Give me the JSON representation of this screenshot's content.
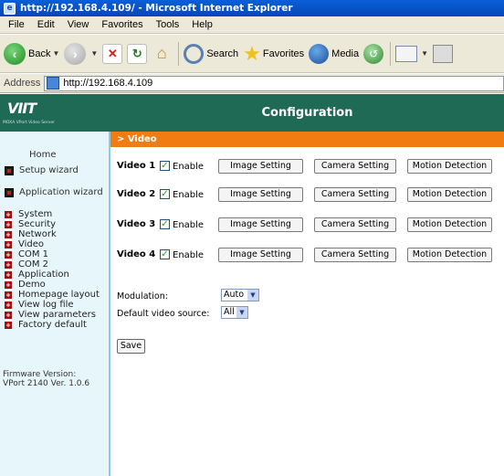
{
  "window": {
    "title": "http://192.168.4.109/ - Microsoft Internet Explorer"
  },
  "menu": [
    "File",
    "Edit",
    "View",
    "Favorites",
    "Tools",
    "Help"
  ],
  "toolbar": {
    "back": "Back",
    "search": "Search",
    "favorites": "Favorites",
    "media": "Media"
  },
  "address": {
    "label": "Address",
    "url": "http://192.168.4.109"
  },
  "header": {
    "logo": "VIIT",
    "logo_sub": "MOXA VPort Video Server",
    "title": "Configuration"
  },
  "section": {
    "title": "> Video"
  },
  "sidebar": {
    "home": "Home",
    "wizards": [
      "Setup wizard",
      "Application wizard"
    ],
    "links": [
      "System",
      "Security",
      "Network",
      "Video",
      "COM 1",
      "COM 2",
      "Application",
      "Demo",
      "Homepage layout",
      "View log file",
      "View parameters",
      "Factory default"
    ],
    "firmware_label": "Firmware Version:",
    "firmware_value": "VPort 2140 Ver. 1.0.6"
  },
  "videos": [
    {
      "label": "Video 1",
      "enable_label": "Enable",
      "checked": true
    },
    {
      "label": "Video 2",
      "enable_label": "Enable",
      "checked": true
    },
    {
      "label": "Video 3",
      "enable_label": "Enable",
      "checked": true
    },
    {
      "label": "Video 4",
      "enable_label": "Enable",
      "checked": true
    }
  ],
  "buttons": {
    "image": "Image Setting",
    "camera": "Camera Setting",
    "motion": "Motion Detection"
  },
  "form": {
    "modulation_label": "Modulation:",
    "modulation_value": "Auto",
    "default_source_label": "Default video source:",
    "default_source_value": "All",
    "save": "Save"
  },
  "colors": {
    "header": "#1f6a55",
    "section_bar": "#f07c12",
    "sidebar_bg": "#e6f6fb"
  }
}
